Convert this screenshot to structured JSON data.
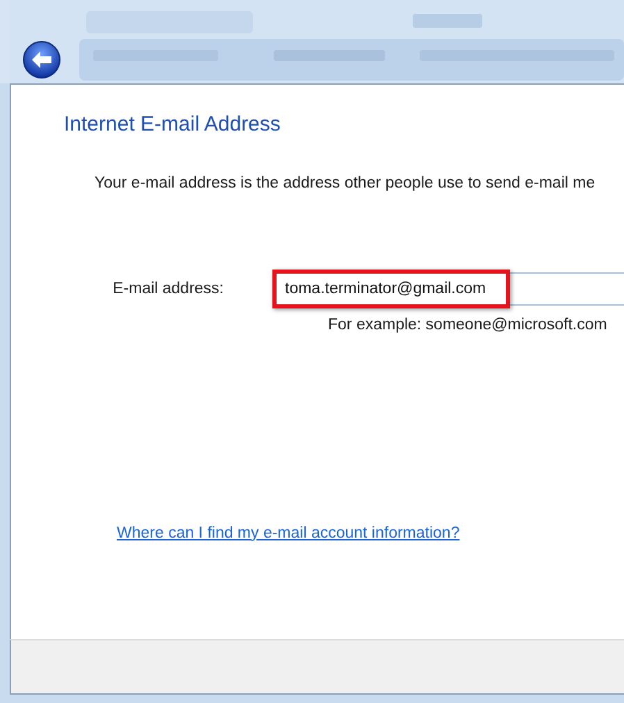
{
  "heading": "Internet E-mail Address",
  "description": "Your e-mail address is the address other people use to send e-mail me",
  "email": {
    "label": "E-mail address:",
    "value": "toma.terminator@gmail.com",
    "highlighted": true,
    "example": "For example: someone@microsoft.com"
  },
  "help_link": "Where can I find my e-mail account information?"
}
